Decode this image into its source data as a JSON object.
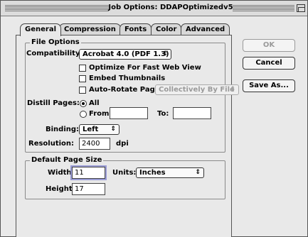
{
  "window": {
    "title": "Job Options: DDAPOptimizedv5"
  },
  "tabs": [
    {
      "label": "General",
      "active": true
    },
    {
      "label": "Compression",
      "active": false
    },
    {
      "label": "Fonts",
      "active": false
    },
    {
      "label": "Color",
      "active": false
    },
    {
      "label": "Advanced",
      "active": false
    }
  ],
  "file_options": {
    "group_title": "File Options",
    "compatibility_label": "Compatibility:",
    "compatibility_value": "Acrobat 4.0 (PDF 1.3)",
    "optimize_label": "Optimize For Fast Web View",
    "optimize_checked": false,
    "embed_thumbnails_label": "Embed Thumbnails",
    "embed_thumbnails_checked": false,
    "auto_rotate_label": "Auto-Rotate Pages:",
    "auto_rotate_checked": false,
    "auto_rotate_value": "Collectively By File",
    "distill_label": "Distill Pages:",
    "all_label": "All",
    "all_selected": true,
    "from_label": "From:",
    "from_value": "",
    "to_label": "To:",
    "to_value": "",
    "binding_label": "Binding:",
    "binding_value": "Left",
    "resolution_label": "Resolution:",
    "resolution_value": "2400",
    "resolution_unit": "dpi"
  },
  "page_size": {
    "group_title": "Default Page Size",
    "width_label": "Width:",
    "width_value": "11",
    "units_label": "Units:",
    "units_value": "Inches",
    "height_label": "Height:",
    "height_value": "17"
  },
  "buttons": {
    "ok": "OK",
    "cancel": "Cancel",
    "save_as": "Save As..."
  },
  "icons": {
    "popup_arrow": "updown-arrows-icon",
    "zoom_box": "zoom-box-icon"
  }
}
